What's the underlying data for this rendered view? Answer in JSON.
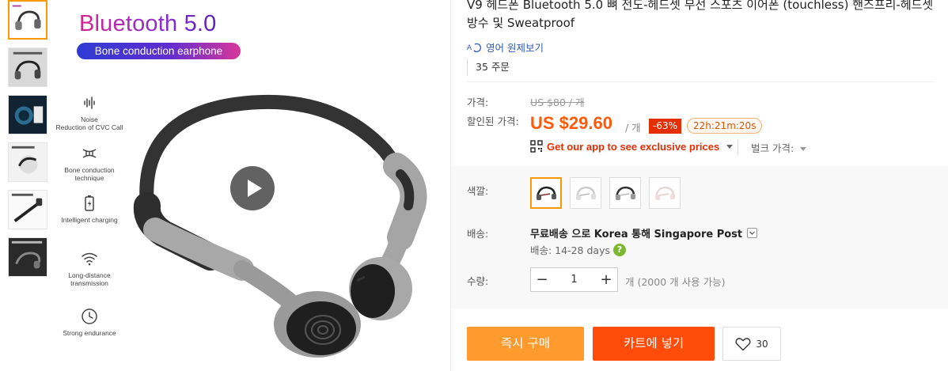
{
  "gallery": {
    "promo_title": "Bluetooth 5.0",
    "promo_subtitle": "Bone conduction earphone",
    "features": [
      {
        "icon": "noise-icon",
        "label": "Noise\nReduction of CVC Call"
      },
      {
        "icon": "dna-icon",
        "label": "Bone conduction\ntechnique"
      },
      {
        "icon": "battery-icon",
        "label": "Intelligent charging"
      },
      {
        "icon": "wifi-icon",
        "label": "Long-distance\ntransmission"
      },
      {
        "icon": "clock-icon",
        "label": "Strong endurance"
      }
    ],
    "thumbnail_count": 6,
    "play_icon": "play-icon"
  },
  "product": {
    "title": "V9 헤드폰 Bluetooth 5.0 뼈 전도-헤드셋 무선 스포츠 이어폰 (touchless) 핸즈프리-헤드셋 방수 및 Sweatproof",
    "translate_label": "영어 원제보기",
    "orders": "35 주문"
  },
  "price": {
    "label": "가격:",
    "old": "US $80 / 개",
    "discount_label": "할인된 가격:",
    "current": "US $29.60",
    "unit": "/ 개",
    "discount": "-63%",
    "timer": "22h:21m:20s",
    "app_promo": "Get our app to see exclusive prices",
    "bulk": "벌크 가격:"
  },
  "options": {
    "color_label": "색깔:",
    "colors": [
      "black",
      "white",
      "black-white",
      "pink"
    ],
    "shipping_label": "배송:",
    "shipping_main": "무료배송 으로 Korea 통해 Singapore Post",
    "shipping_days": "배송: 14-28 days",
    "quantity_label": "수량:",
    "quantity_value": "1",
    "quantity_available": "개 (2000 개 사용 가능)"
  },
  "actions": {
    "buy_now": "즉시 구매",
    "add_to_cart": "카트에 넣기",
    "wishlist_count": "30"
  },
  "colors": {
    "accent_orange": "#ff9900",
    "price_orange": "#ff5a0a",
    "buy_button": "#ff9b2e",
    "cart_button": "#ff4c0b",
    "discount_red": "#e62e04",
    "link_blue": "#2e5bb8"
  }
}
